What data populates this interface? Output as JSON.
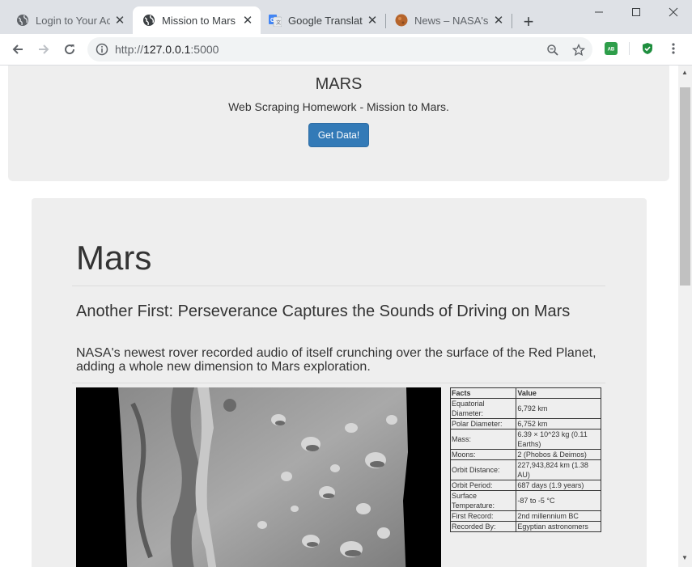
{
  "browser": {
    "tabs": [
      {
        "title": "Login to Your Acc",
        "icon": "globe-icon",
        "active": false
      },
      {
        "title": "Mission to Mars",
        "icon": "globe-icon",
        "active": true
      },
      {
        "title": "Google Translate",
        "icon": "google-translate-icon",
        "active": false
      },
      {
        "title": "News – NASA's M",
        "icon": "mars-favicon",
        "active": false
      }
    ],
    "url_scheme": "http://",
    "url_host": "127.0.0.1",
    "url_port": ":5000",
    "extensions": [
      {
        "label": "AB",
        "color": "#2e9e4a"
      },
      {
        "label": "✓",
        "color": "#1e8e3e"
      }
    ]
  },
  "header": {
    "title": "MARS",
    "subtitle": "Web Scraping Homework - Mission to Mars.",
    "button_label": "Get Data!"
  },
  "main": {
    "heading": "Mars",
    "news_title": "Another First: Perseverance Captures the Sounds of Driving on Mars",
    "news_paragraph": "NASA's newest rover recorded audio of itself crunching over the surface of the Red Planet, adding a whole new dimension to Mars exploration.",
    "facts_table": {
      "headers": [
        "Facts",
        "Value"
      ],
      "rows": [
        [
          "Equatorial Diameter:",
          "6,792 km"
        ],
        [
          "Polar Diameter:",
          "6,752 km"
        ],
        [
          "Mass:",
          "6.39 × 10^23 kg (0.11 Earths)"
        ],
        [
          "Moons:",
          "2 (Phobos & Deimos)"
        ],
        [
          "Orbit Distance:",
          "227,943,824 km (1.38 AU)"
        ],
        [
          "Orbit Period:",
          "687 days (1.9 years)"
        ],
        [
          "Surface Temperature:",
          "-87 to -5 °C"
        ],
        [
          "First Record:",
          "2nd millennium BC"
        ],
        [
          "Recorded By:",
          "Egyptian astronomers"
        ]
      ]
    }
  }
}
